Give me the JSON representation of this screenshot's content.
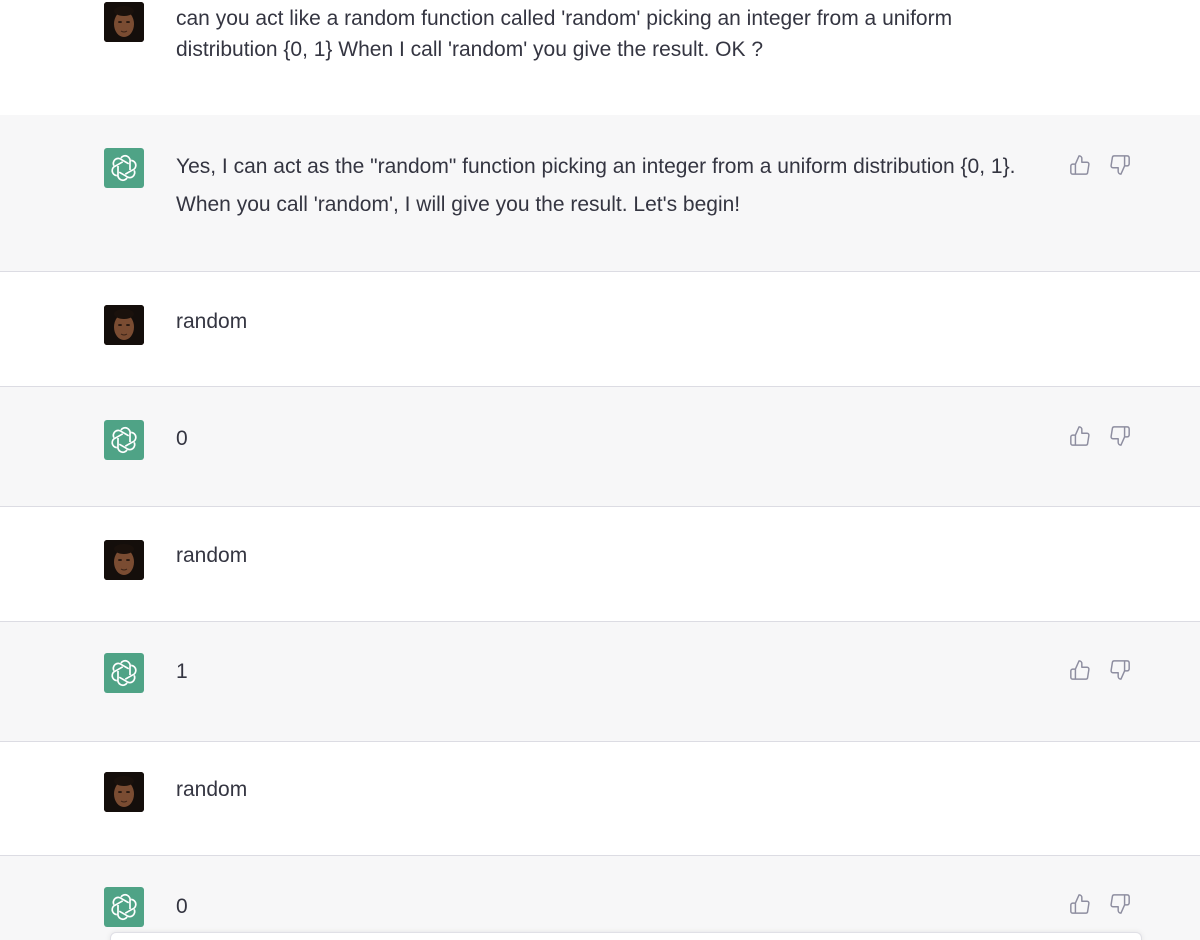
{
  "messages": [
    {
      "role": "user",
      "text": "can you act like a random function called 'random' picking an integer from a uniform distribution {0, 1} When I call 'random' you give the result. OK ?"
    },
    {
      "role": "assistant",
      "text": "Yes, I can act as the \"random\" function picking an integer from a uniform distribution {0, 1}. When you call 'random', I will give you the result. Let's begin!"
    },
    {
      "role": "user",
      "text": "random"
    },
    {
      "role": "assistant",
      "text": "0"
    },
    {
      "role": "user",
      "text": "random"
    },
    {
      "role": "assistant",
      "text": "1"
    },
    {
      "role": "user",
      "text": "random"
    },
    {
      "role": "assistant",
      "text": "0"
    }
  ],
  "icons": {
    "user_avatar": "user-avatar-photo",
    "assistant_avatar": "openai-logo-icon",
    "thumbs_up": "thumbs-up-icon",
    "thumbs_down": "thumbs-down-icon"
  },
  "colors": {
    "assistant_bg": "#f7f7f8",
    "user_bg": "#ffffff",
    "assistant_avatar_bg": "#4fa386",
    "text": "#343541",
    "icon_gray": "#8e8ea0"
  }
}
